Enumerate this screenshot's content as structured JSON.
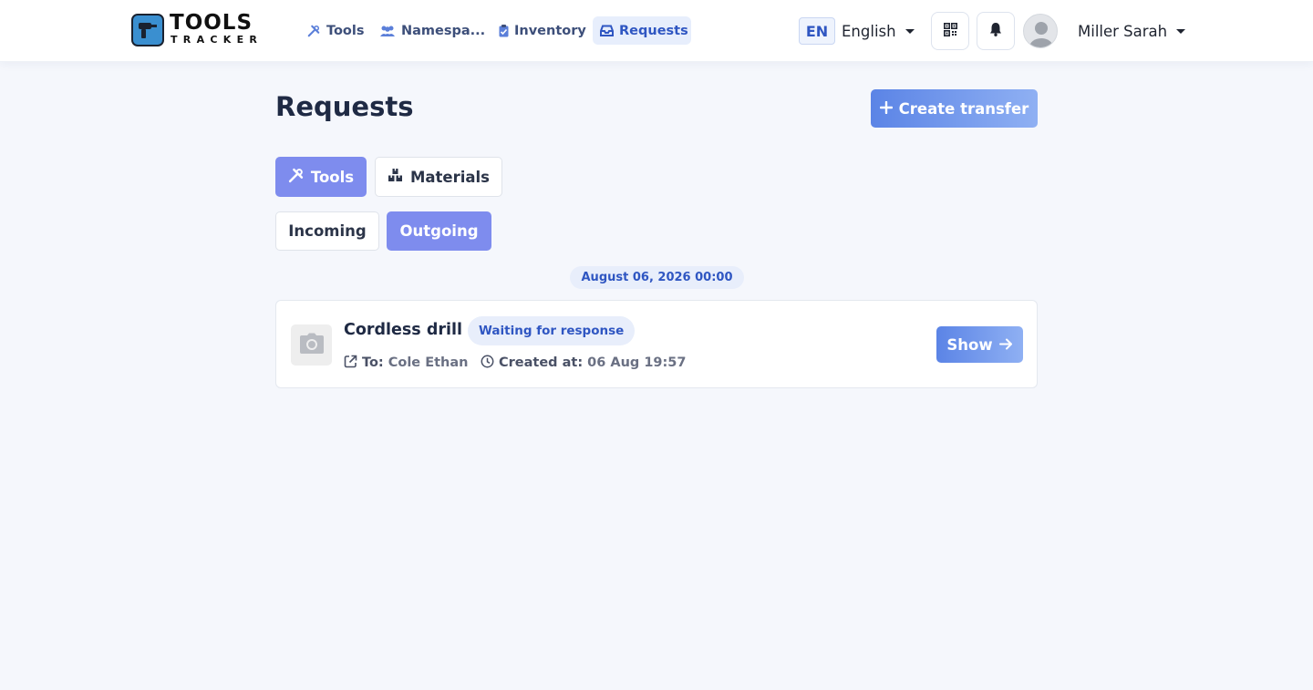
{
  "app": {
    "logo_top": "TOOLS",
    "logo_bottom": "TRACKER"
  },
  "nav": {
    "items": [
      {
        "label": "Tools",
        "icon": "tools-icon",
        "active": false
      },
      {
        "label": "Namespa...",
        "icon": "users-icon",
        "active": false
      },
      {
        "label": "Inventory",
        "icon": "clipboard-check-icon",
        "active": false
      },
      {
        "label": "Requests",
        "icon": "inbox-icon",
        "active": true
      }
    ]
  },
  "header": {
    "lang_code": "EN",
    "lang_name": "English",
    "user_name": "Miller Sarah"
  },
  "page": {
    "title": "Requests",
    "create_label": "Create transfer"
  },
  "tabs": {
    "type": [
      {
        "label": "Tools",
        "active": true
      },
      {
        "label": "Materials",
        "active": false
      }
    ],
    "direction": [
      {
        "label": "Incoming",
        "active": false
      },
      {
        "label": "Outgoing",
        "active": true
      }
    ]
  },
  "requests": {
    "date_group": "August 06, 2026 00:00",
    "items": [
      {
        "title": "Cordless drill",
        "status": "Waiting for response",
        "to_label": "To:",
        "to_value": "Cole Ethan",
        "created_label": "Created at:",
        "created_value": "06 Aug 19:57",
        "action_label": "Show"
      }
    ]
  },
  "colors": {
    "accent": "#7e8cee",
    "primary_gradient_start": "#5b84e6",
    "primary_gradient_end": "#8fb0f3",
    "badge_text": "#2f56c2"
  }
}
